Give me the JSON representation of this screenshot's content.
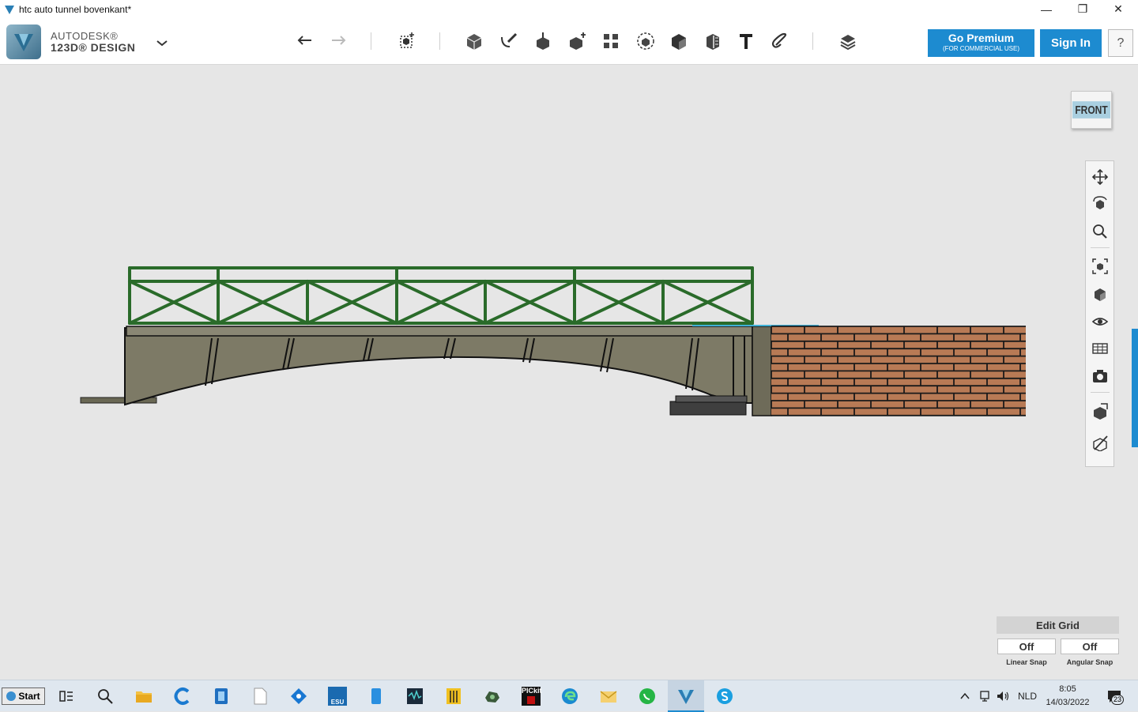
{
  "window": {
    "title": "htc auto tunnel bovenkant*",
    "minimize_glyph": "—",
    "restore_glyph": "❐",
    "close_glyph": "✕"
  },
  "brand": {
    "line1": "AUTODESK®",
    "line2": "123D® DESIGN"
  },
  "toolbar": {
    "undo": "undo-icon",
    "redo": "redo-icon",
    "tools": [
      "transform-icon",
      "primitives-icon",
      "sketch-icon",
      "construct-icon",
      "modify-icon",
      "pattern-icon",
      "grouping-icon",
      "combine-icon",
      "measure-icon",
      "text-icon",
      "snap-icon",
      "materials-icon"
    ]
  },
  "premium": {
    "label": "Go Premium",
    "sublabel": "(FOR COMMERCIAL USE)"
  },
  "sign_in": "Sign In",
  "help": "?",
  "viewcube": {
    "face": "FRONT"
  },
  "navbar": {
    "items": [
      "pan-icon",
      "orbit-icon",
      "zoom-icon",
      "fit-icon",
      "views-icon",
      "visibility-icon",
      "materials-view-icon",
      "camera-icon",
      "grid-icon",
      "snap-view-icon"
    ]
  },
  "grid": {
    "edit_label": "Edit Grid",
    "linear_value": "Off",
    "angular_value": "Off",
    "linear_label": "Linear Snap",
    "angular_label": "Angular Snap"
  },
  "taskbar": {
    "start": "Start",
    "lang": "NLD",
    "time": "8:05",
    "date": "14/03/2022",
    "notif_count": "23",
    "esu_label": "ESU",
    "pickit_label": "PICkit"
  },
  "colors": {
    "accent": "#1d8bd0",
    "rail": "#2a6b2a",
    "bridge": "#7d7a66",
    "brick": "#b87a55"
  }
}
